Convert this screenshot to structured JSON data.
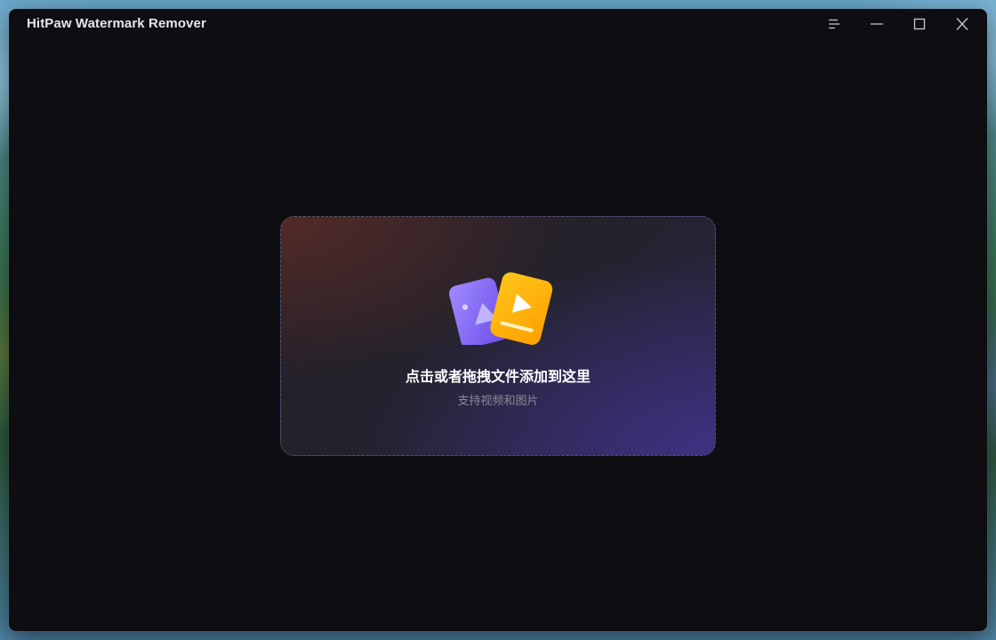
{
  "window": {
    "title": "HitPaw Watermark Remover",
    "controls": [
      {
        "name": "menu",
        "icon": "menu-icon"
      },
      {
        "name": "minimize",
        "icon": "minimize-icon"
      },
      {
        "name": "maximize",
        "icon": "maximize-icon"
      },
      {
        "name": "close",
        "icon": "close-icon"
      }
    ]
  },
  "dropzone": {
    "title": "点击或者拖拽文件添加到这里",
    "subtitle": "支持视频和图片",
    "icons": [
      "image-file-icon",
      "video-file-icon"
    ]
  },
  "colors": {
    "window_bg": "#0d0d12",
    "image_icon": "#8b6cf6",
    "video_icon": "#ffb700"
  }
}
